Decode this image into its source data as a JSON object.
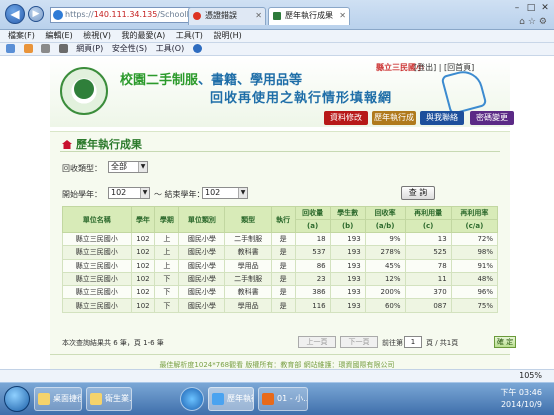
{
  "browser": {
    "url_prefix": "https://",
    "url_host": "140.111.34.135",
    "url_path": "/SchoolFun_old/Ex",
    "cert_error": "憑證錯誤",
    "tabs": [
      {
        "label": "140.111.34..."
      },
      {
        "label": "歷年執行成果"
      }
    ],
    "menu": [
      "檔案(F)",
      "編輯(E)",
      "檢視(V)",
      "我的最愛(A)",
      "工具(T)",
      "說明(H)"
    ],
    "commands": [
      "網頁(P)",
      "安全性(S)",
      "工具(O)"
    ],
    "status_zoom": "105%"
  },
  "site": {
    "seal_text": "MINISTRY OF EDUCATION",
    "title_line1_a": "校園二手制服",
    "title_line1_b": "、書籍、學用品等",
    "title_line2": "回收再使用之執行情形填報網",
    "school_name": "縣立三民國小",
    "top_links": "[登出] | [回首頁]",
    "nav": {
      "data_edit": "資料修改",
      "yearly_results": "歷年執行成果",
      "contact": "與我聯絡",
      "password": "密碼變更"
    }
  },
  "main": {
    "breadcrumb": "歷年執行成果",
    "filters": {
      "type_label": "回收類型：",
      "type_value": "全部",
      "start_label": "開始學年：",
      "start_value": "102",
      "tilde": "～ 結束學年：",
      "end_value": "102"
    },
    "query_button": "查 詢",
    "table": {
      "headers_top": [
        "單位名稱",
        "學年",
        "學期",
        "單位類別",
        "類型",
        "執行",
        "回收量",
        "學生數",
        "回收率",
        "再利用量",
        "再利用率"
      ],
      "headers_sub": [
        "(a)",
        "(b)",
        "(a/b)",
        "(c)",
        "(c/a)"
      ],
      "rows": [
        [
          "縣立三民國小",
          "102",
          "上",
          "國民小學",
          "二手制服",
          "是",
          "18",
          "193",
          "9%",
          "13",
          "72%"
        ],
        [
          "縣立三民國小",
          "102",
          "上",
          "國民小學",
          "教科書",
          "是",
          "537",
          "193",
          "278%",
          "525",
          "98%"
        ],
        [
          "縣立三民國小",
          "102",
          "上",
          "國民小學",
          "學用品",
          "是",
          "86",
          "193",
          "45%",
          "78",
          "91%"
        ],
        [
          "縣立三民國小",
          "102",
          "下",
          "國民小學",
          "二手制服",
          "是",
          "23",
          "193",
          "12%",
          "11",
          "48%"
        ],
        [
          "縣立三民國小",
          "102",
          "下",
          "國民小學",
          "教科書",
          "是",
          "386",
          "193",
          "200%",
          "370",
          "96%"
        ],
        [
          "縣立三民國小",
          "102",
          "下",
          "國民小學",
          "學用品",
          "是",
          "116",
          "193",
          "60%",
          "087",
          "75%"
        ]
      ]
    },
    "result_info": "本次查詢結果共 6 筆，頁 1-6 筆",
    "pager": {
      "prev": "上一頁",
      "next": "下一頁",
      "page_label": "前往第",
      "page_value": "1",
      "total": "頁 / 共1頁",
      "go": "確 定"
    },
    "footer": "最佳解析度1024*768觀看 版權所有：教育部 網站維護：環資國際有限公司"
  },
  "taskbar": {
    "items": [
      "桌面捷徑",
      "衛生業...",
      "歷年執行...",
      "01 - 小..."
    ],
    "time": "下午 03:46",
    "date": "2014/10/9"
  }
}
